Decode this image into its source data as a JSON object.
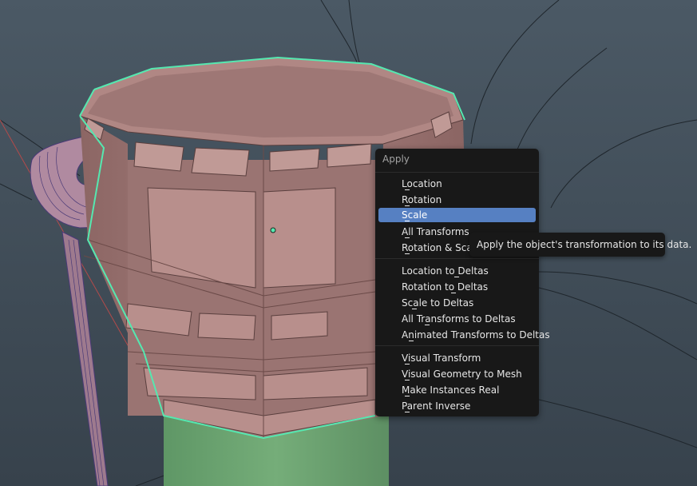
{
  "colors": {
    "viewport_bg": "#3f4c57",
    "menu_bg": "#181818",
    "menu_highlight": "#5680c2",
    "selection_outline": "#55e8b0",
    "mesh_pink": "#a07a78",
    "mesh_green": "#6aa06f"
  },
  "menu": {
    "title": "Apply",
    "active_item": "Scale",
    "items": [
      {
        "label": "Location"
      },
      {
        "label": "Rotation"
      },
      {
        "label": "Scale"
      },
      {
        "label": "All Transforms"
      },
      {
        "label": "Rotation & Scale"
      },
      {
        "label": "Location to Deltas"
      },
      {
        "label": "Rotation to Deltas"
      },
      {
        "label": "Scale to Deltas"
      },
      {
        "label": "All Transforms to Deltas"
      },
      {
        "label": "Animated Transforms to Deltas"
      },
      {
        "label": "Visual Transform"
      },
      {
        "label": "Visual Geometry to Mesh"
      },
      {
        "label": "Make Instances Real"
      },
      {
        "label": "Parent Inverse"
      }
    ]
  },
  "tooltip": {
    "text": "Apply the object's transformation to its data."
  }
}
